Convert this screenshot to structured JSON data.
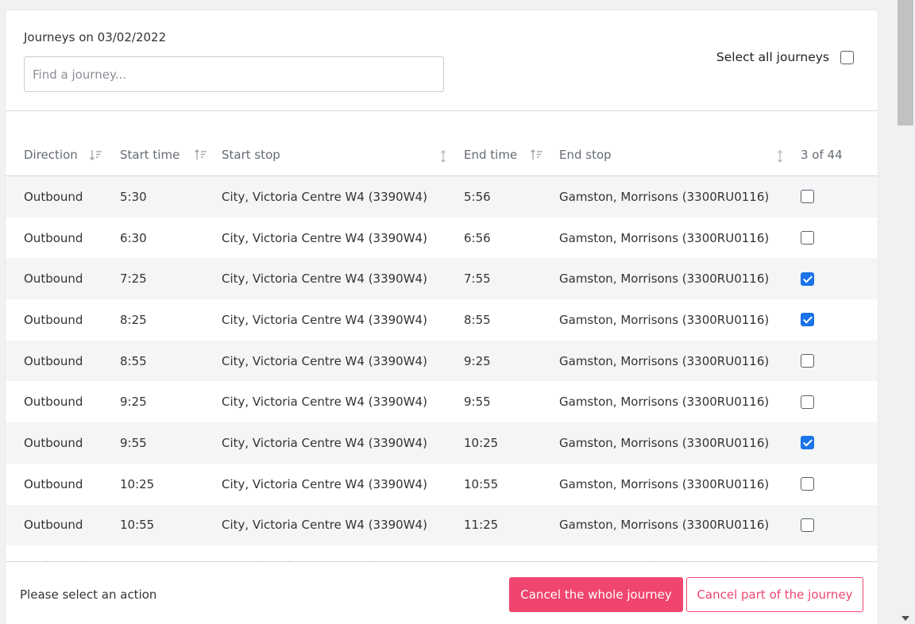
{
  "header": {
    "date_label": "Journeys on 03/02/2022",
    "search_placeholder": "Find a journey...",
    "select_all_label": "Select all journeys",
    "select_all_checked": false
  },
  "table": {
    "columns": {
      "direction": "Direction",
      "start_time": "Start time",
      "start_stop": "Start stop",
      "end_time": "End time",
      "end_stop": "End stop",
      "selected_count": "3 of 44"
    },
    "rows": [
      {
        "direction": "Outbound",
        "start_time": "5:30",
        "start_stop": "City, Victoria Centre W4 (3390W4)",
        "end_time": "5:56",
        "end_stop": "Gamston, Morrisons (3300RU0116)",
        "checked": false
      },
      {
        "direction": "Outbound",
        "start_time": "6:30",
        "start_stop": "City, Victoria Centre W4 (3390W4)",
        "end_time": "6:56",
        "end_stop": "Gamston, Morrisons (3300RU0116)",
        "checked": false
      },
      {
        "direction": "Outbound",
        "start_time": "7:25",
        "start_stop": "City, Victoria Centre W4 (3390W4)",
        "end_time": "7:55",
        "end_stop": "Gamston, Morrisons (3300RU0116)",
        "checked": true
      },
      {
        "direction": "Outbound",
        "start_time": "8:25",
        "start_stop": "City, Victoria Centre W4 (3390W4)",
        "end_time": "8:55",
        "end_stop": "Gamston, Morrisons (3300RU0116)",
        "checked": true
      },
      {
        "direction": "Outbound",
        "start_time": "8:55",
        "start_stop": "City, Victoria Centre W4 (3390W4)",
        "end_time": "9:25",
        "end_stop": "Gamston, Morrisons (3300RU0116)",
        "checked": false
      },
      {
        "direction": "Outbound",
        "start_time": "9:25",
        "start_stop": "City, Victoria Centre W4 (3390W4)",
        "end_time": "9:55",
        "end_stop": "Gamston, Morrisons (3300RU0116)",
        "checked": false
      },
      {
        "direction": "Outbound",
        "start_time": "9:55",
        "start_stop": "City, Victoria Centre W4 (3390W4)",
        "end_time": "10:25",
        "end_stop": "Gamston, Morrisons (3300RU0116)",
        "checked": true
      },
      {
        "direction": "Outbound",
        "start_time": "10:25",
        "start_stop": "City, Victoria Centre W4 (3390W4)",
        "end_time": "10:55",
        "end_stop": "Gamston, Morrisons (3300RU0116)",
        "checked": false
      },
      {
        "direction": "Outbound",
        "start_time": "10:55",
        "start_stop": "City, Victoria Centre W4 (3390W4)",
        "end_time": "11:25",
        "end_stop": "Gamston, Morrisons (3300RU0116)",
        "checked": false
      }
    ]
  },
  "footer": {
    "message": "Please select an action",
    "cancel_whole_label": "Cancel the whole journey",
    "cancel_part_label": "Cancel part of the journey"
  },
  "colors": {
    "accent": "#f0456e",
    "checkbox_checked": "#1a73e8",
    "row_stripe": "#f4f5f6"
  }
}
